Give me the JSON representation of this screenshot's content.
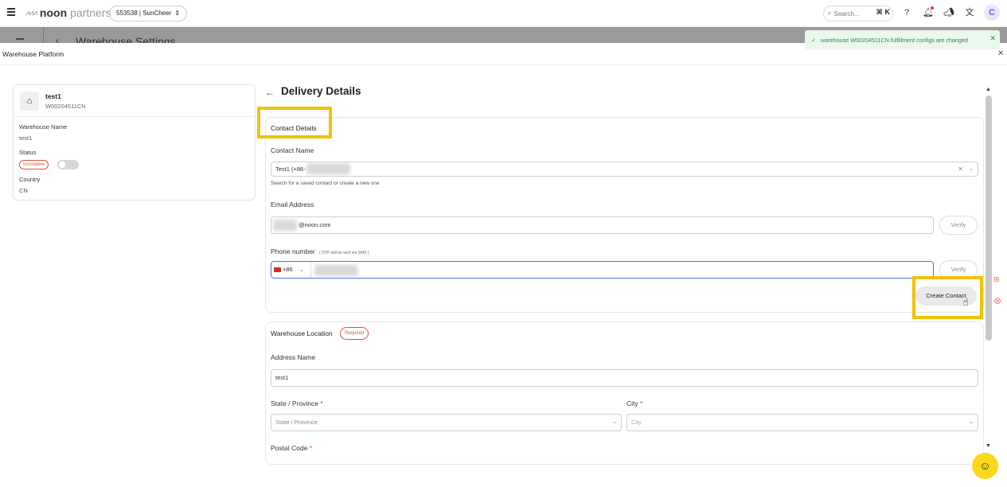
{
  "topbar": {
    "brand_noon": "noon",
    "brand_partners": "partners",
    "account": "553538 | SunCheer",
    "search_placeholder": "Search...",
    "shortcut": "⌘ K",
    "avatar_initial": "C"
  },
  "background": {
    "page_title": "Warehouse Settings"
  },
  "toast": {
    "message": "warehouse W00204511CN fulfillment configs are changed"
  },
  "platform": {
    "title": "Warehouse Platform"
  },
  "warehouse_card": {
    "name": "test1",
    "code": "W00204511CN",
    "name_label": "Warehouse Name",
    "name_value": "test1",
    "status_label": "Status",
    "status_badge": "Incomplete",
    "country_label": "Country",
    "country_value": "CN"
  },
  "delivery": {
    "title": "Delivery Details",
    "contact_section": "Contact Details",
    "contact_name_label": "Contact Name",
    "contact_name_value": "Test1 (+86-",
    "contact_helper": "Search for a saved contact or create a new one",
    "email_label": "Email Address",
    "email_value": "@noon.com",
    "verify_label": "Verify",
    "phone_label": "Phone number",
    "phone_hint": "( OTP will be sent via SMS )",
    "phone_code": "+86",
    "create_contact": "Create Contact"
  },
  "location": {
    "section": "Warehouse Location",
    "required_badge": "Required",
    "address_name_label": "Address Name",
    "address_name_value": "test1",
    "state_label": "State / Province",
    "state_placeholder": "State / Province",
    "city_label": "City",
    "city_placeholder": "City",
    "postal_label": "Postal Code",
    "required_mark": "*"
  },
  "colors": {
    "highlight": "#f2c200",
    "accent": "#4a6cff",
    "toast_bg": "#e9f7ec",
    "badge": "#e0562b"
  }
}
